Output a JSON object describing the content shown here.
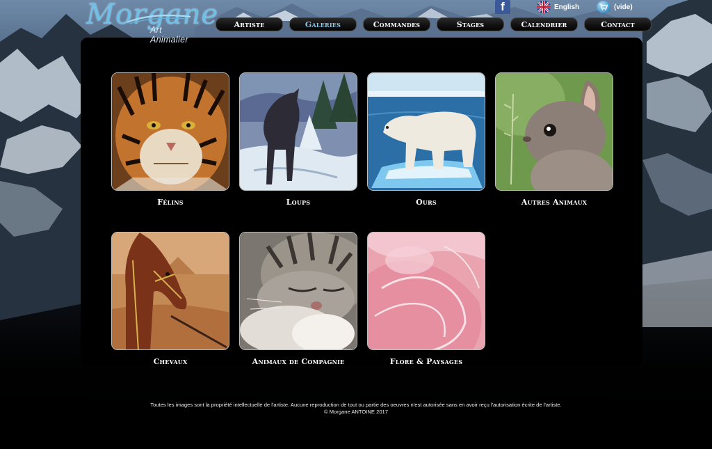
{
  "header": {
    "logo_script": "Morgane",
    "logo_sub": "Art Animalier",
    "facebook_icon": "facebook-icon",
    "language_label": "English",
    "cart_label": "(vide)"
  },
  "nav": [
    {
      "label": "Artiste",
      "active": false
    },
    {
      "label": "Galeries",
      "active": true
    },
    {
      "label": "Commandes",
      "active": false
    },
    {
      "label": "Stages",
      "active": false
    },
    {
      "label": "Calendrier",
      "active": false
    },
    {
      "label": "Contact",
      "active": false
    }
  ],
  "galleries": [
    {
      "label": "Félins",
      "image": "tiger"
    },
    {
      "label": "Loups",
      "image": "wolf"
    },
    {
      "label": "Ours",
      "image": "polar-bear"
    },
    {
      "label": "Autres Animaux",
      "image": "rabbit"
    },
    {
      "label": "Chevaux",
      "image": "horse"
    },
    {
      "label": "Animaux de Compagnie",
      "image": "cat"
    },
    {
      "label": "Flore & Paysages",
      "image": "rose"
    }
  ],
  "footer": {
    "line1": "Toutes les images sont la propriété intellectuelle de l'artiste. Aucune reproduction de tout ou partie des oeuvres n'est autorisée sans en avoir reçu l'autorisation écrite de l'artiste.",
    "line2": "© Morgane ANTOINE 2017"
  },
  "colors": {
    "active_nav": "#8fc6e6",
    "logo": "#6fc0e8",
    "facebook": "#3b5998"
  }
}
